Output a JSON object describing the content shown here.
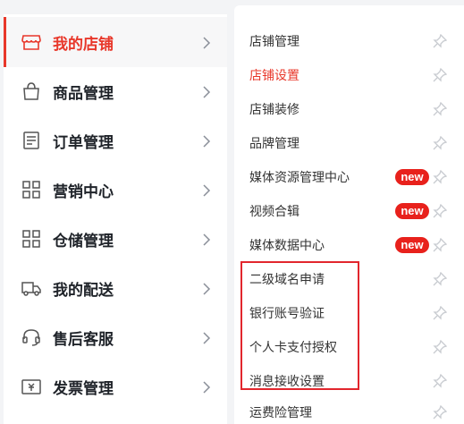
{
  "colors": {
    "accent": "#e8372a",
    "badge": "#e8211c",
    "highlight": "#e2262d"
  },
  "nav": {
    "items": [
      {
        "label": "我的店铺",
        "icon": "store-icon",
        "active": true
      },
      {
        "label": "商品管理",
        "icon": "shopping-bag-icon",
        "active": false
      },
      {
        "label": "订单管理",
        "icon": "document-icon",
        "active": false
      },
      {
        "label": "营销中心",
        "icon": "grid-icon",
        "active": false
      },
      {
        "label": "仓储管理",
        "icon": "warehouse-grid-icon",
        "active": false
      },
      {
        "label": "我的配送",
        "icon": "delivery-truck-icon",
        "active": false
      },
      {
        "label": "售后客服",
        "icon": "headset-icon",
        "active": false
      },
      {
        "label": "发票管理",
        "icon": "invoice-icon",
        "active": false
      }
    ]
  },
  "submenu": {
    "items": [
      {
        "label": "店铺管理",
        "badge": ""
      },
      {
        "label": "店铺设置",
        "badge": "",
        "active": true
      },
      {
        "label": "店铺装修",
        "badge": ""
      },
      {
        "label": "品牌管理",
        "badge": ""
      },
      {
        "label": "媒体资源管理中心",
        "badge": "new"
      },
      {
        "label": "视频合辑",
        "badge": "new"
      },
      {
        "label": "媒体数据中心",
        "badge": "new"
      },
      {
        "label": "二级域名申请",
        "badge": ""
      },
      {
        "label": "银行账号验证",
        "badge": ""
      },
      {
        "label": "个人卡支付授权",
        "badge": ""
      },
      {
        "label": "消息接收设置",
        "badge": ""
      },
      {
        "label": "运费险管理",
        "badge": ""
      }
    ]
  }
}
